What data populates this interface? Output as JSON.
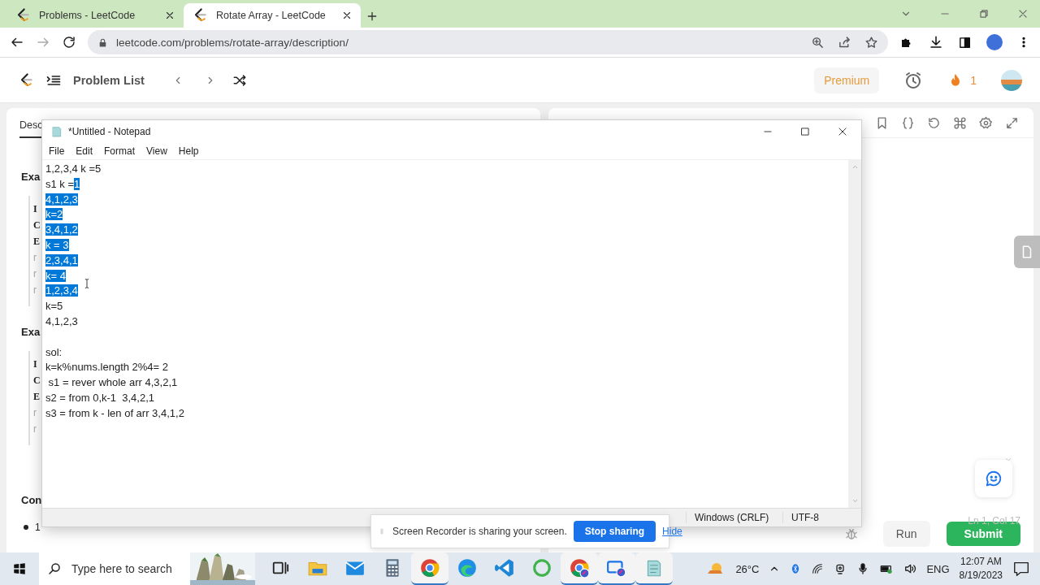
{
  "browser": {
    "tabs": [
      {
        "title": "Problems - LeetCode",
        "selected": false
      },
      {
        "title": "Rotate Array - LeetCode",
        "selected": true
      }
    ],
    "url": "leetcode.com/problems/rotate-array/description/"
  },
  "leetcode": {
    "nav_title": "Problem List",
    "premium": "Premium",
    "streak": "1",
    "left_tab": "Desc",
    "sections": [
      {
        "kind": "example",
        "heading": "Exa",
        "lines": [
          {
            "kind": "label",
            "text": "I"
          },
          {
            "kind": "label",
            "text": "C"
          },
          {
            "kind": "label",
            "text": "E"
          },
          {
            "kind": "faint",
            "text": "r"
          },
          {
            "kind": "faint",
            "text": "r"
          },
          {
            "kind": "faint",
            "text": "r"
          }
        ]
      },
      {
        "kind": "example",
        "heading": "Exa",
        "lines": [
          {
            "kind": "label",
            "text": "I"
          },
          {
            "kind": "label",
            "text": "C"
          },
          {
            "kind": "label",
            "text": "E"
          },
          {
            "kind": "faint",
            "text": "r"
          },
          {
            "kind": "faint",
            "text": "r"
          }
        ]
      },
      {
        "kind": "list",
        "heading": "Con",
        "lines": [
          {
            "kind": "bullet",
            "text": "1"
          }
        ]
      }
    ],
    "cursor_position": "Ln 1, Col 17",
    "run": "Run",
    "submit": "Submit"
  },
  "notepad": {
    "title": "*Untitled - Notepad",
    "menu": [
      "File",
      "Edit",
      "Format",
      "View",
      "Help"
    ],
    "paragraphs": [
      {
        "lines": [
          {
            "segments": [
              {
                "text": "1,2,3,4 k =5",
                "selected": false
              }
            ]
          },
          {
            "segments": [
              {
                "text": "s1 k =",
                "selected": false
              },
              {
                "text": "1",
                "selected": true
              }
            ]
          },
          {
            "segments": [
              {
                "text": "4,1,2,3",
                "selected": true
              }
            ]
          },
          {
            "segments": [
              {
                "text": "k=2",
                "selected": true
              }
            ]
          },
          {
            "segments": [
              {
                "text": "3,4,1,2",
                "selected": true
              }
            ]
          },
          {
            "segments": [
              {
                "text": "k = 3",
                "selected": true
              }
            ]
          },
          {
            "segments": [
              {
                "text": "2,3,4,1",
                "selected": true
              }
            ]
          },
          {
            "segments": [
              {
                "text": "k= 4",
                "selected": true
              }
            ]
          },
          {
            "segments": [
              {
                "text": "1,2,3,4",
                "selected": true
              }
            ]
          },
          {
            "segments": [
              {
                "text": "k=5",
                "selected": false
              }
            ]
          },
          {
            "segments": [
              {
                "text": "4,1,2,3",
                "selected": false
              }
            ]
          }
        ]
      },
      {
        "lines": [
          {
            "segments": [
              {
                "text": "sol:",
                "selected": false
              }
            ]
          },
          {
            "segments": [
              {
                "text": "k=k%nums.length 2%4= 2",
                "selected": false
              }
            ]
          },
          {
            "segments": [
              {
                "text": " s1 = rever whole arr 4,3,2,1",
                "selected": false
              }
            ]
          },
          {
            "segments": [
              {
                "text": "s2 = from 0,k-1  3,4,2,1",
                "selected": false
              }
            ]
          },
          {
            "segments": [
              {
                "text": "s3 = from k - len of arr 3,4,1,2",
                "selected": false
              }
            ]
          }
        ]
      }
    ],
    "status": [
      "Windows (CRLF)",
      "UTF-8"
    ]
  },
  "recorder": {
    "message": "Screen Recorder is sharing your screen.",
    "stop": "Stop sharing",
    "hide": "Hide"
  },
  "taskbar": {
    "placeholder": "Type here to search",
    "apps": [
      {
        "kind": "task-view",
        "running": false
      },
      {
        "kind": "folder",
        "running": false
      },
      {
        "kind": "mail",
        "running": false
      },
      {
        "kind": "calculator",
        "running": false
      },
      {
        "kind": "chrome",
        "running": true
      },
      {
        "kind": "edge",
        "running": false
      },
      {
        "kind": "vscode",
        "running": false
      },
      {
        "kind": "ring",
        "running": false
      },
      {
        "kind": "chrome-share",
        "running": true
      },
      {
        "kind": "window-share",
        "running": true
      },
      {
        "kind": "notepad",
        "running": true
      }
    ],
    "weather": "26°C",
    "language": "ENG",
    "time": "12:07 AM",
    "date": "8/19/2023"
  }
}
